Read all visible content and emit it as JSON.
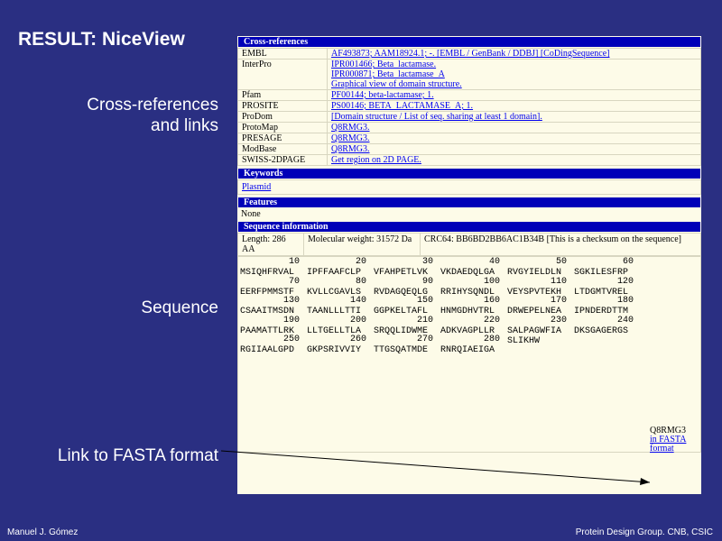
{
  "slide": {
    "title": "RESULT: NiceView",
    "labels": {
      "crossrefs": [
        "Cross-references",
        "and links"
      ],
      "sequence": "Sequence",
      "fasta_link": "Link to FASTA format"
    },
    "footer_left": "Manuel J. Gómez",
    "footer_right": "Protein Design Group. CNB, CSIC",
    "colors": {
      "background": "#2a2f82",
      "header_bar": "#0000b8",
      "panel": "#fdfbe8",
      "link": "#0000ee"
    }
  },
  "screenshot": {
    "crossrefs_header": "Cross-references",
    "crossrefs": [
      {
        "db": "EMBL",
        "lines": [
          "AF493873; AAM18924.1; -. [EMBL / GenBank / DDBJ] [CoDingSequence]"
        ]
      },
      {
        "db": "InterPro",
        "lines": [
          "IPR001466; Beta_lactamase.",
          "IPR000871; Beta_lactamase_A",
          "Graphical view of domain structure."
        ]
      },
      {
        "db": "Pfam",
        "lines": [
          "PF00144; beta-lactamase; 1."
        ]
      },
      {
        "db": "PROSITE",
        "lines": [
          "PS00146; BETA_LACTAMASE_A; 1."
        ]
      },
      {
        "db": "ProDom",
        "lines": [
          "[Domain structure / List of seq. sharing at least 1 domain]."
        ]
      },
      {
        "db": "ProtoMap",
        "lines": [
          "Q8RMG3."
        ]
      },
      {
        "db": "PRESAGE",
        "lines": [
          "Q8RMG3."
        ]
      },
      {
        "db": "ModBase",
        "lines": [
          "Q8RMG3."
        ]
      },
      {
        "db": "SWISS-2DPAGE",
        "lines": [
          "Get region on 2D PAGE."
        ]
      }
    ],
    "keywords_header": "Keywords",
    "keyword": "Plasmid",
    "features_header": "Features",
    "features_value": "None",
    "seqinfo_header": "Sequence information",
    "seqinfo": {
      "length": "Length: 286 AA",
      "mw": "Molecular weight: 31572 Da",
      "crc": "CRC64: BB6BD2BB6AC1B34B [This is a checksum on the sequence]"
    },
    "sequence_rows": [
      {
        "nums": [
          "10",
          "20",
          "30",
          "40",
          "50",
          "60"
        ],
        "aa": [
          "MSIQHFRVAL",
          "IPFFAAFCLP",
          "VFAHPETLVK",
          "VKDAEDQLGA",
          "RVGYIELDLN",
          "SGKILESFRP"
        ]
      },
      {
        "nums": [
          "70",
          "80",
          "90",
          "100",
          "110",
          "120"
        ],
        "aa": [
          "EERFPMMSTF",
          "KVLLCGAVLS",
          "RVDAGQEQLG",
          "RRIHYSQNDL",
          "VEYSPVTEKH",
          "LTDGMTVREL"
        ]
      },
      {
        "nums": [
          "130",
          "140",
          "150",
          "160",
          "170",
          "180"
        ],
        "aa": [
          "CSAAITMSDN",
          "TAANLLLTTI",
          "GGPKELTAFL",
          "HNMGDHVTRL",
          "DRWEPELNEA",
          "IPNDERDTTM"
        ]
      },
      {
        "nums": [
          "190",
          "200",
          "210",
          "220",
          "230",
          "240"
        ],
        "aa": [
          "PAAMATTLRK",
          "LLTGELLTLA",
          "SRQQLIDWME",
          "ADKVAGPLLR",
          "SALPAGWFIA",
          "DKSGAGERGS"
        ]
      },
      {
        "nums": [
          "250",
          "260",
          "270",
          "280",
          "",
          ""
        ],
        "aa": [
          "RGIIAALGPD",
          "GKPSRIVVIY",
          "TTGSQATMDE",
          "RNRQIAEIGA",
          "SLIKHW",
          ""
        ]
      }
    ],
    "fasta_box": [
      "Q8RMG3",
      "in FASTA",
      "format"
    ]
  }
}
